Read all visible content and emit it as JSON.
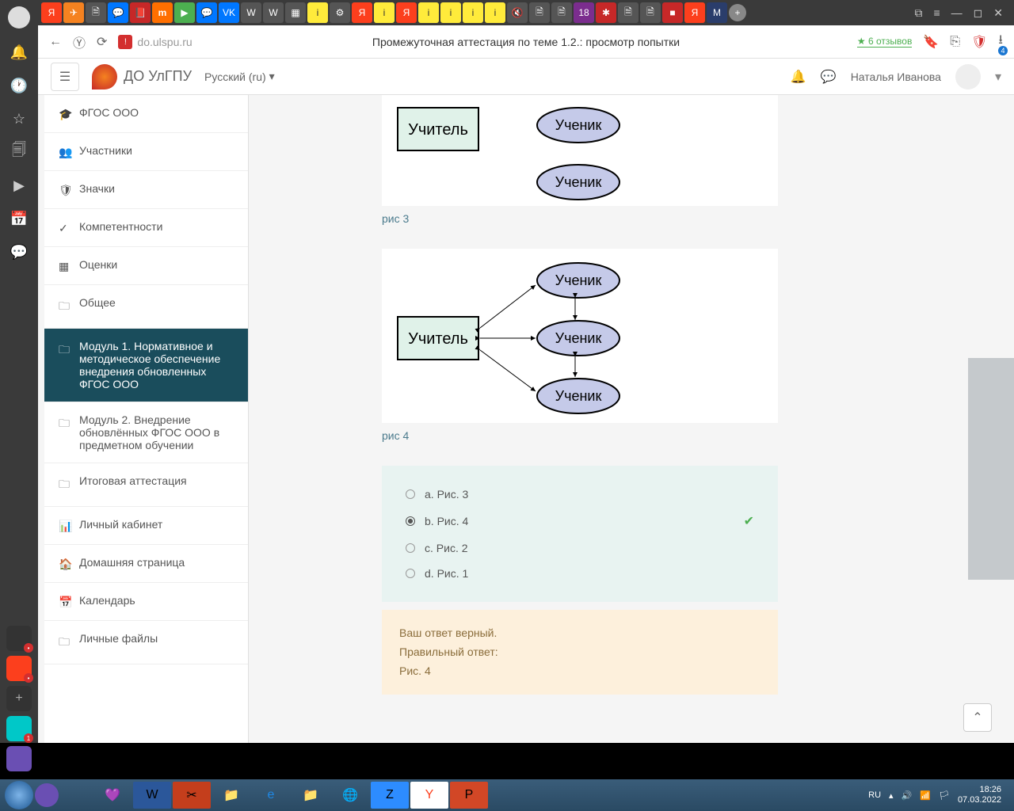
{
  "browser": {
    "url": "do.ulspu.ru",
    "page_title": "Промежуточная аттестация по теме 1.2.: просмотр попытки",
    "reviews": "6 отзывов",
    "download_badge": "4"
  },
  "header": {
    "site_name": "ДО УлГПУ",
    "language": "Русский (ru)",
    "user_name": "Наталья Иванова"
  },
  "nav": {
    "items": [
      {
        "icon": "🎓",
        "label": "ФГОС ООО"
      },
      {
        "icon": "👥",
        "label": "Участники"
      },
      {
        "icon": "🛡",
        "label": "Значки"
      },
      {
        "icon": "✓",
        "label": "Компетентности"
      },
      {
        "icon": "▦",
        "label": "Оценки"
      },
      {
        "icon": "🗀",
        "label": "Общее"
      },
      {
        "icon": "🗀",
        "label": "Модуль 1. Нормативное и методическое обеспечение внедрения обновленных ФГОС ООО",
        "active": true
      },
      {
        "icon": "🗀",
        "label": "Модуль 2. Внедрение обновлённых ФГОС ООО в предметном обучении"
      },
      {
        "icon": "🗀",
        "label": "Итоговая аттестация"
      },
      {
        "icon": "📊",
        "label": "Личный кабинет"
      },
      {
        "icon": "🏠",
        "label": "Домашняя страница"
      },
      {
        "icon": "📅",
        "label": "Календарь"
      },
      {
        "icon": "🗀",
        "label": "Личные файлы"
      }
    ]
  },
  "diagram": {
    "teacher": "Учитель",
    "student": "Ученик",
    "fig3": "рис 3",
    "fig4": "рис 4"
  },
  "answers": {
    "options": [
      {
        "label": "a. Рис. 3",
        "selected": false,
        "correct": false
      },
      {
        "label": "b. Рис. 4",
        "selected": true,
        "correct": true
      },
      {
        "label": "c. Рис. 2",
        "selected": false,
        "correct": false
      },
      {
        "label": "d. Рис. 1",
        "selected": false,
        "correct": false
      }
    ]
  },
  "feedback": {
    "line1": "Ваш ответ верный.",
    "line2": "Правильный ответ:",
    "line3": "Рис. 4"
  },
  "taskbar": {
    "lang": "RU",
    "time": "18:26",
    "date": "07.03.2022"
  }
}
